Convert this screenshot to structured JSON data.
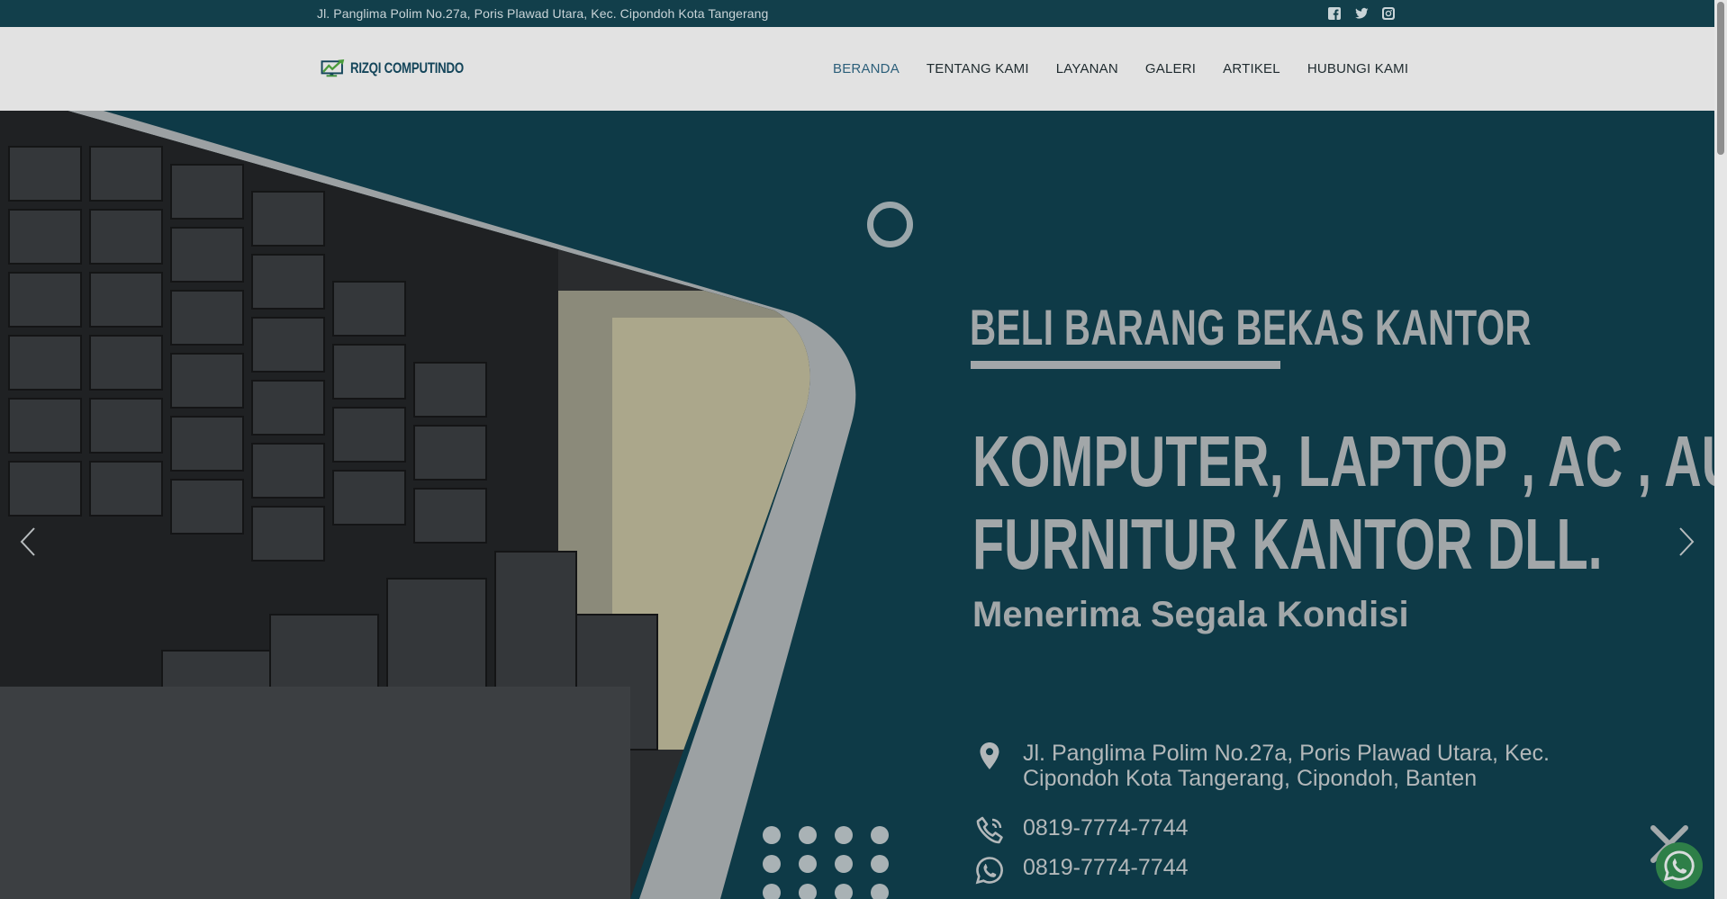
{
  "topbar": {
    "address": "Jl. Panglima Polim No.27a, Poris Plawad Utara, Kec. Cipondoh Kota Tangerang",
    "socials": [
      "facebook-icon",
      "twitter-icon",
      "instagram-icon"
    ]
  },
  "header": {
    "logo_text": "RIZQI COMPUTINDO",
    "menu": [
      {
        "label": "BERANDA",
        "active": true
      },
      {
        "label": "TENTANG KAMI",
        "active": false
      },
      {
        "label": "LAYANAN",
        "active": false
      },
      {
        "label": "GALERI",
        "active": false
      },
      {
        "label": "ARTIKEL",
        "active": false
      },
      {
        "label": "HUBUNGI KAMI",
        "active": false
      }
    ]
  },
  "hero": {
    "kicker": "BELI BARANG BEKAS KANTOR",
    "headline_line1": "KOMPUTER, LAPTOP , AC , AUDIO,",
    "headline_line2": "FURNITUR KANTOR DLL.",
    "subheadline": "Menerima Segala Kondisi",
    "address_line1": "Jl. Panglima Polim No.27a, Poris Plawad Utara, Kec.",
    "address_line2": "Cipondoh Kota Tangerang, Cipondoh, Banten",
    "phone": "0819-7774-7744",
    "whatsapp": "0819-7774-7744"
  },
  "colors": {
    "background": "#0e3a47",
    "topbar": "#123f4b",
    "navbar": "#e2e2e2",
    "active_menu": "#2c5f7a",
    "hero_text": "#a2a7a9",
    "whatsapp": "#2e7f48"
  }
}
